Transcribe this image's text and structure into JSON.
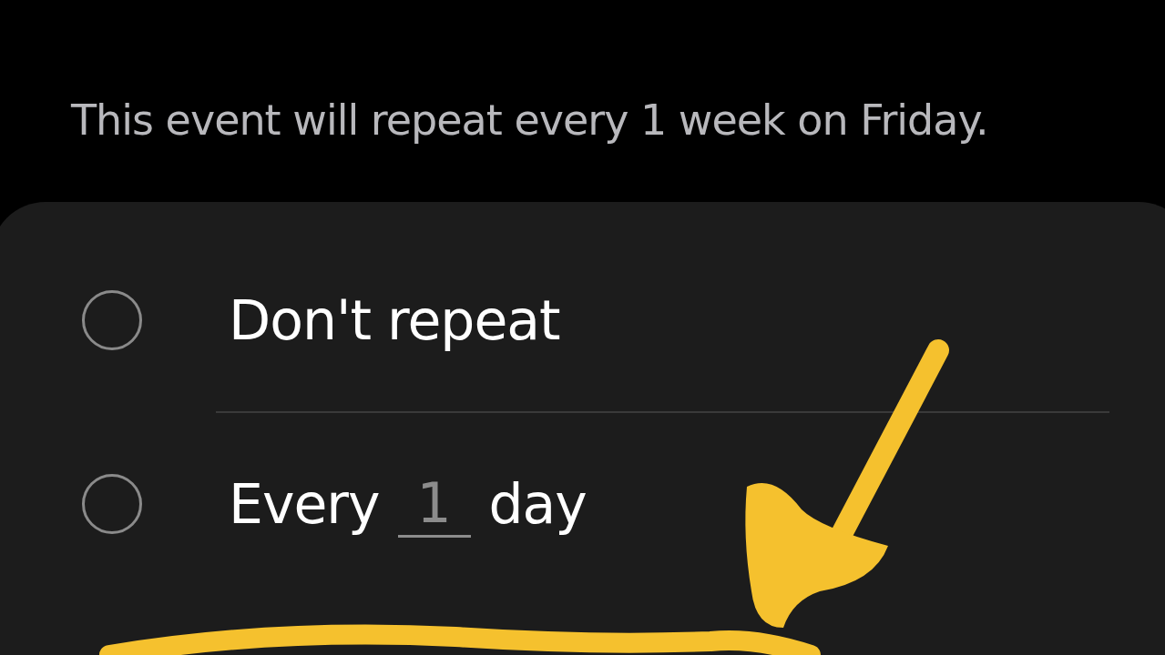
{
  "description": "This event will repeat every 1 week on Friday.",
  "options": [
    {
      "kind": "plain",
      "label": "Don't repeat",
      "selected": false
    },
    {
      "kind": "interval",
      "prefix": "Every",
      "value": "1",
      "suffix": "day",
      "selected": false
    }
  ]
}
